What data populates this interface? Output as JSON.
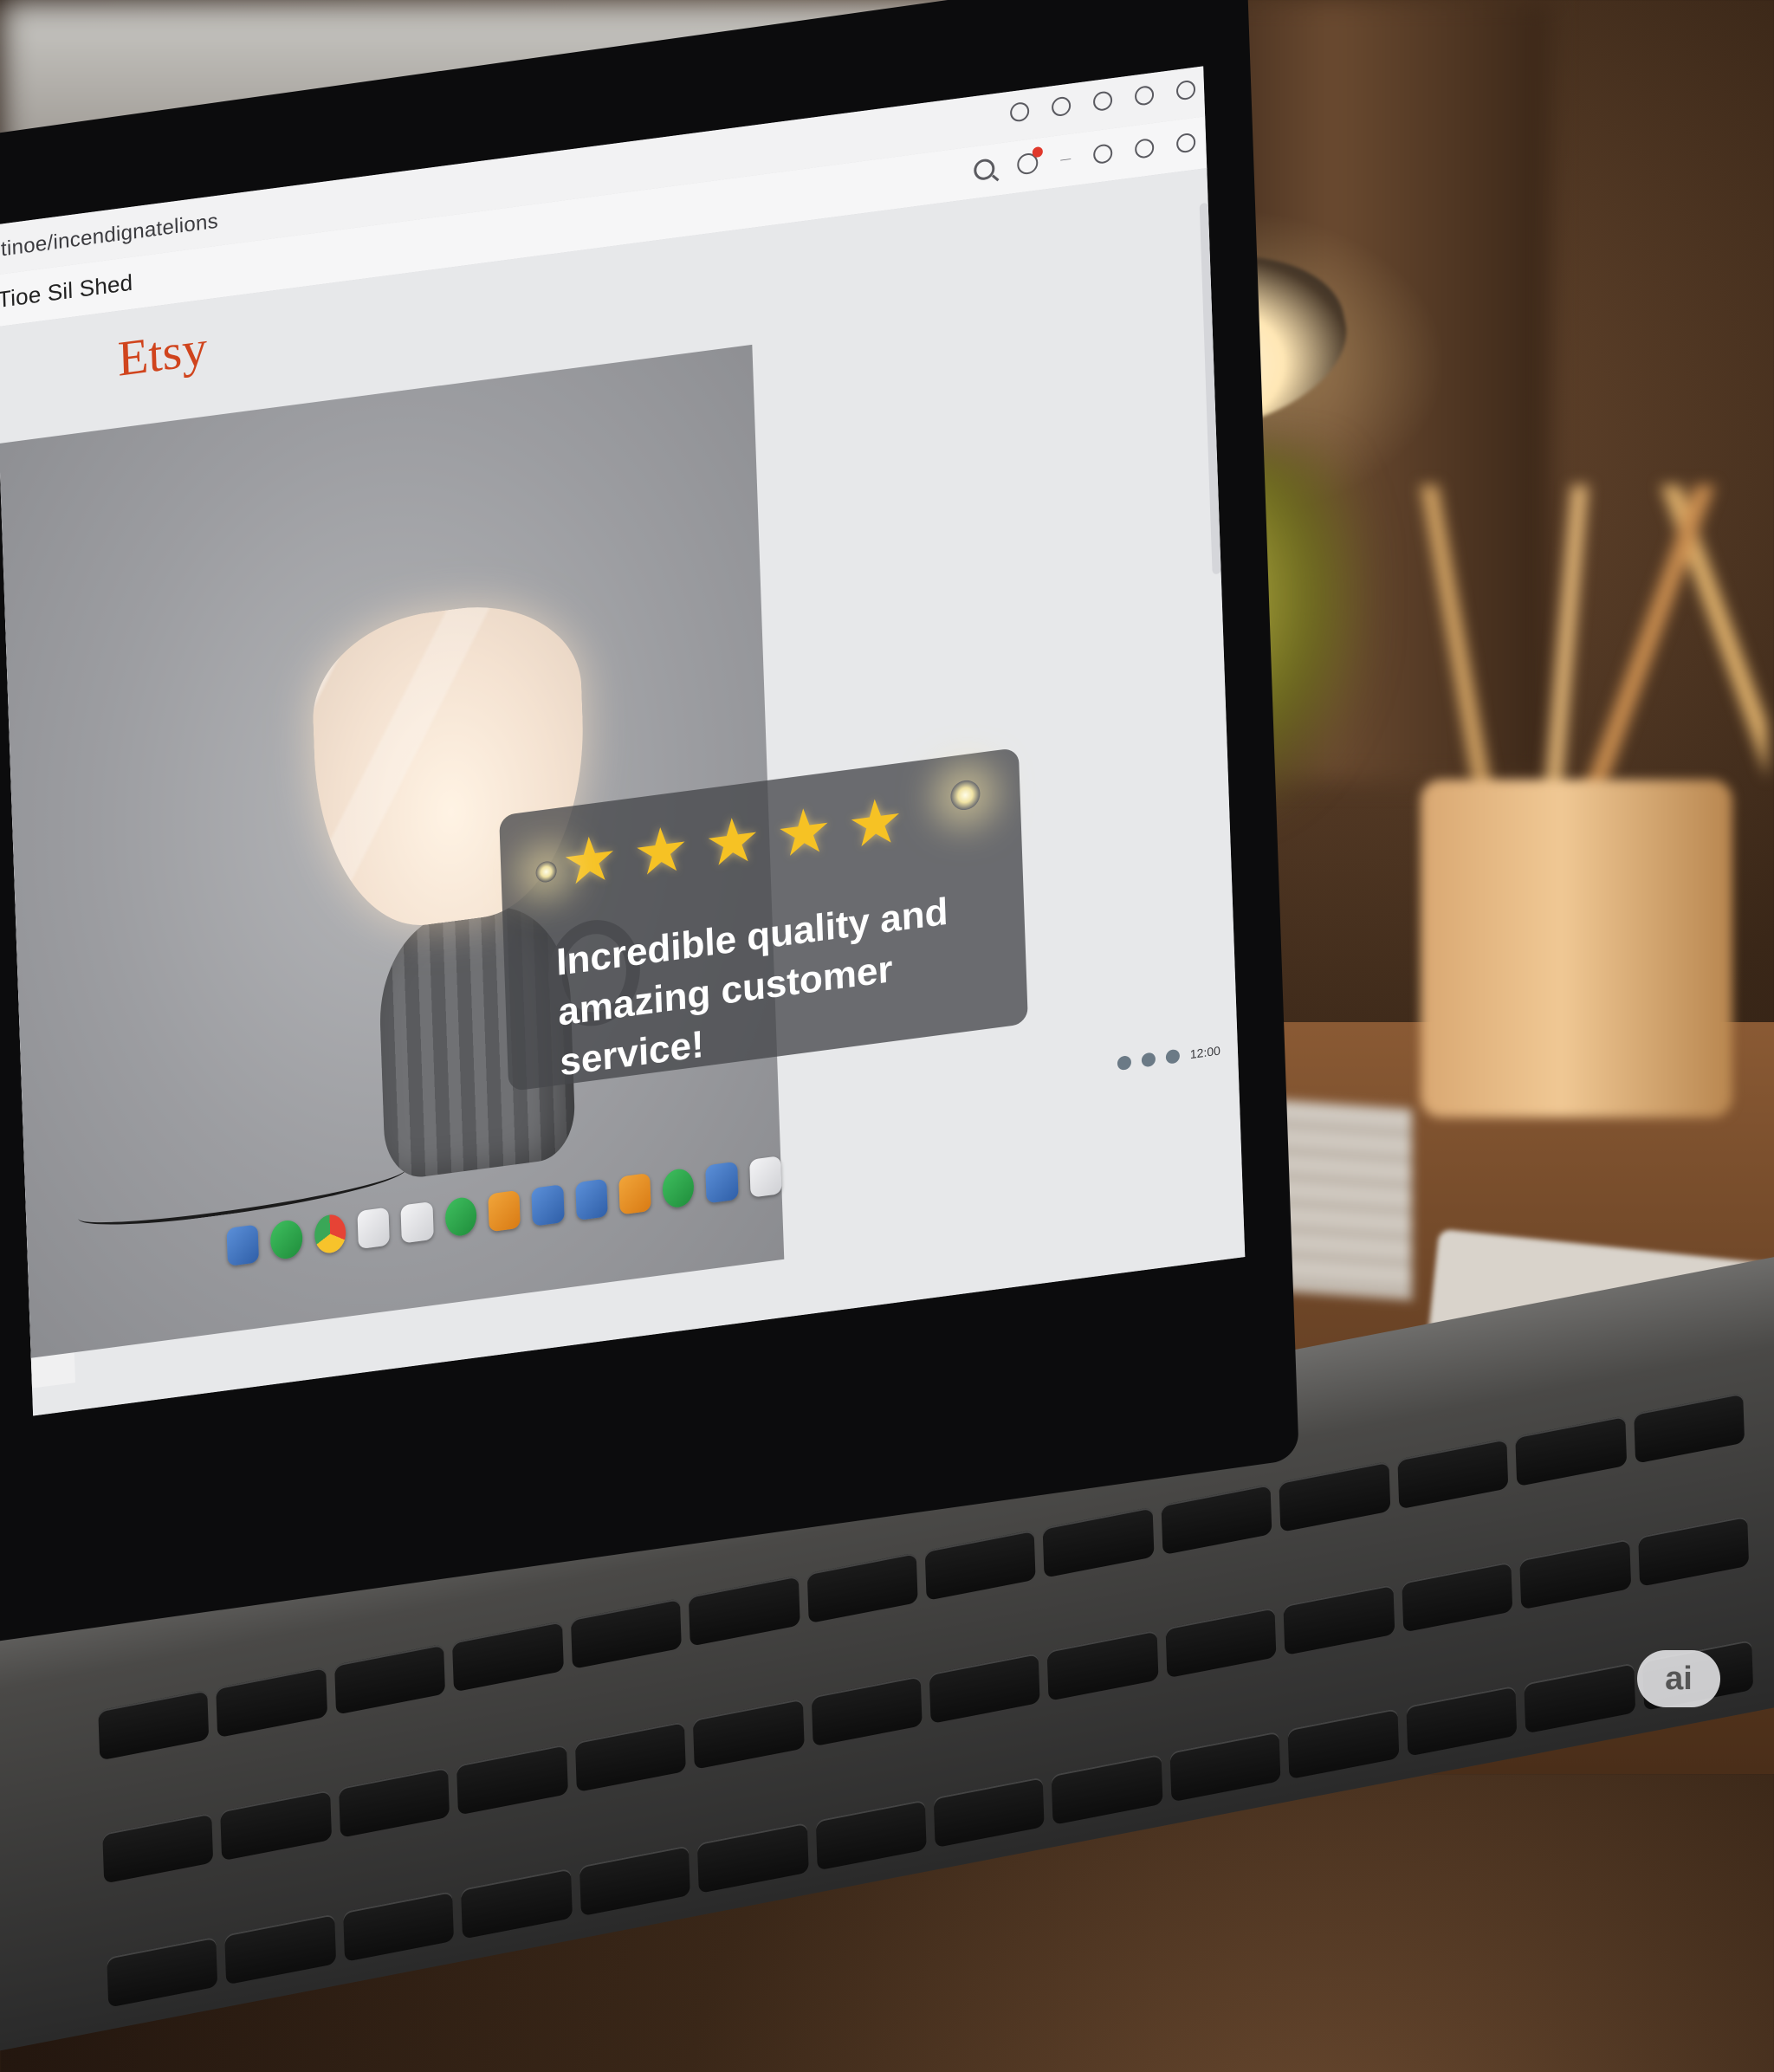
{
  "browser": {
    "url": "tinoe/incendignatelions",
    "tab_title": "Tioe Sil Shed",
    "tab_small_label": "—"
  },
  "page": {
    "logo": "Etsy",
    "review": {
      "stars": 5,
      "star_glyph": "★",
      "text_line1": "Incredible quality and",
      "text_line2": "amazing customer service!"
    }
  },
  "taskbar": {
    "time": "12:00",
    "date": ""
  },
  "badge": {
    "label": "ai"
  },
  "colors": {
    "etsy_orange": "#d0441d",
    "star_yellow": "#f6c224",
    "notification_red": "#e0382b"
  },
  "icons": [
    "search-icon",
    "notification-icon",
    "menu-icon",
    "chrome-icon",
    "finder-icon",
    "folder-icon"
  ]
}
